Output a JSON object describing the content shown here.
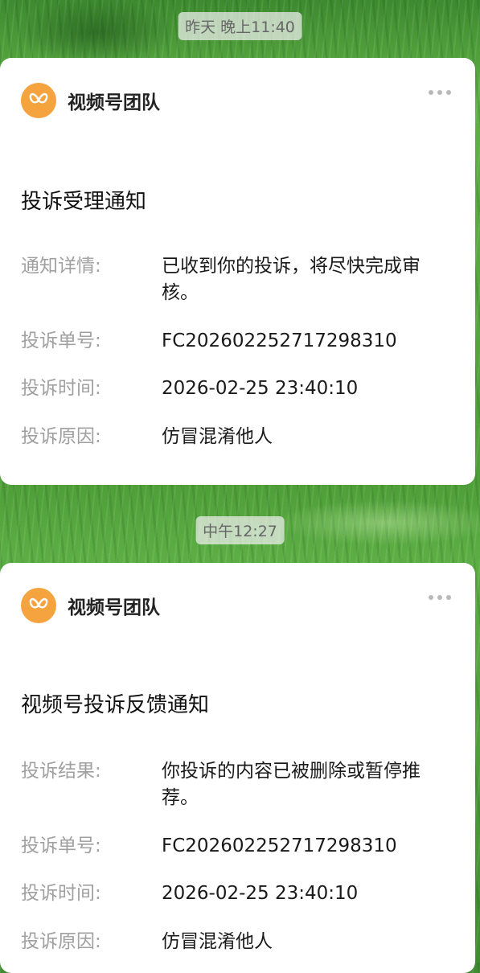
{
  "messages": [
    {
      "time": "昨天 晚上11:40",
      "sender": "视频号团队",
      "title": "投诉受理通知",
      "rows": [
        {
          "label": "通知详情:",
          "value": "已收到你的投诉，将尽快完成审核。"
        },
        {
          "label": "投诉单号:",
          "value": "FC2026022527172983​10"
        },
        {
          "label": "投诉时间:",
          "value": "2026-02-25 23:40:10"
        },
        {
          "label": "投诉原因:",
          "value": "仿冒混淆他人"
        }
      ]
    },
    {
      "time": "中午12:27",
      "sender": "视频号团队",
      "title": "视频号投诉反馈通知",
      "rows": [
        {
          "label": "投诉结果:",
          "value": "你投诉的内容已被删除或暂停推荐。"
        },
        {
          "label": "投诉单号:",
          "value": "FC202602252717298310"
        },
        {
          "label": "投诉时间:",
          "value": "2026-02-25 23:40:10"
        },
        {
          "label": "投诉原因:",
          "value": "仿冒混淆他人"
        }
      ]
    }
  ],
  "icons": {
    "logo": "channels-butterfly-icon",
    "more": "more-dots-icon"
  },
  "colors": {
    "logo_bg": "#f5a33f",
    "label": "#a0a0a0",
    "background": "#4e9e38"
  }
}
